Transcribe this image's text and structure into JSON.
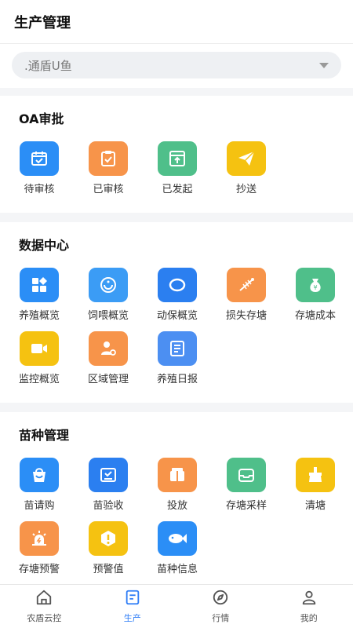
{
  "header": {
    "title": "生产管理"
  },
  "select": {
    "value": ".通盾U鱼"
  },
  "sections": [
    {
      "title": "OA审批",
      "items": [
        {
          "label": "待审核",
          "icon": "calendar-check-icon",
          "color": "#2b8ef6"
        },
        {
          "label": "已审核",
          "icon": "clipboard-check-icon",
          "color": "#f7944a"
        },
        {
          "label": "已发起",
          "icon": "send-box-icon",
          "color": "#4fbf8a"
        },
        {
          "label": "抄送",
          "icon": "paper-plane-icon",
          "color": "#f5c211"
        }
      ]
    },
    {
      "title": "数据中心",
      "items": [
        {
          "label": "养殖概览",
          "icon": "grid-shapes-icon",
          "color": "#2b8ef6"
        },
        {
          "label": "饲喂概览",
          "icon": "feed-bowl-icon",
          "color": "#3b9cf5"
        },
        {
          "label": "动保概览",
          "icon": "shield-oval-icon",
          "color": "#2b7ff0"
        },
        {
          "label": "损失存塘",
          "icon": "fish-bone-icon",
          "color": "#f7944a"
        },
        {
          "label": "存塘成本",
          "icon": "money-bag-icon",
          "color": "#4fbf8a"
        },
        {
          "label": "监控概览",
          "icon": "video-camera-icon",
          "color": "#f5c211"
        },
        {
          "label": "区域管理",
          "icon": "user-gear-icon",
          "color": "#f7944a"
        },
        {
          "label": "养殖日报",
          "icon": "report-list-icon",
          "color": "#4c8ff2"
        }
      ]
    },
    {
      "title": "苗种管理",
      "items": [
        {
          "label": "苗请购",
          "icon": "shopping-bag-icon",
          "color": "#2b8ef6"
        },
        {
          "label": "苗验收",
          "icon": "inbox-check-icon",
          "color": "#2b7ff0"
        },
        {
          "label": "投放",
          "icon": "release-box-icon",
          "color": "#f7944a"
        },
        {
          "label": "存塘采样",
          "icon": "tray-icon",
          "color": "#4fbf8a"
        },
        {
          "label": "清塘",
          "icon": "broom-icon",
          "color": "#f5c211"
        },
        {
          "label": "存塘预警",
          "icon": "alarm-light-icon",
          "color": "#f7944a"
        },
        {
          "label": "预警值",
          "icon": "warning-hexagon-icon",
          "color": "#f5c211"
        },
        {
          "label": "苗种信息",
          "icon": "fish-icon",
          "color": "#2b8ef6"
        }
      ]
    }
  ],
  "tabbar": [
    {
      "label": "农盾云控",
      "icon": "home-icon",
      "active": false
    },
    {
      "label": "生产",
      "icon": "production-icon",
      "active": true
    },
    {
      "label": "行情",
      "icon": "compass-icon",
      "active": false
    },
    {
      "label": "我的",
      "icon": "user-icon",
      "active": false
    }
  ],
  "colors": {
    "accent": "#2f7df6"
  }
}
